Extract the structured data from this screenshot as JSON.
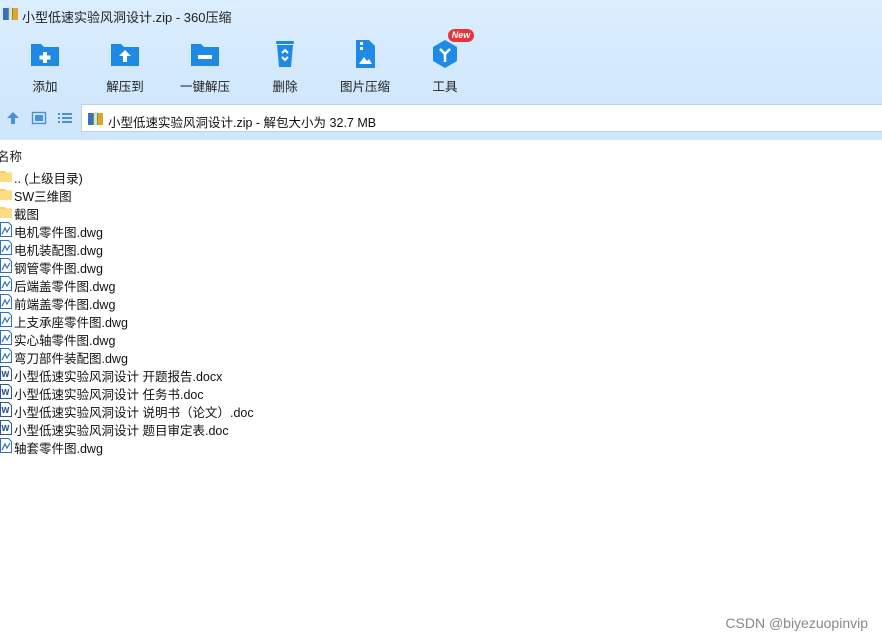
{
  "window": {
    "title": "小型低速实验风洞设计.zip - 360压缩"
  },
  "toolbar": {
    "add_label": "添加",
    "extract_to_label": "解压到",
    "one_click_extract_label": "一键解压",
    "delete_label": "删除",
    "image_compress_label": "图片压缩",
    "tools_label": "工具",
    "tools_badge": "New"
  },
  "address": {
    "path": "小型低速实验风洞设计.zip - 解包大小为 32.7 MB"
  },
  "list": {
    "column_name": "名称",
    "items": [
      {
        "name": ".. (上级目录)",
        "type": "folder"
      },
      {
        "name": "SW三维图",
        "type": "folder"
      },
      {
        "name": "截图",
        "type": "folder"
      },
      {
        "name": "电机零件图.dwg",
        "type": "dwg"
      },
      {
        "name": "电机装配图.dwg",
        "type": "dwg"
      },
      {
        "name": "钢管零件图.dwg",
        "type": "dwg"
      },
      {
        "name": "后端盖零件图.dwg",
        "type": "dwg"
      },
      {
        "name": "前端盖零件图.dwg",
        "type": "dwg"
      },
      {
        "name": "上支承座零件图.dwg",
        "type": "dwg"
      },
      {
        "name": "实心轴零件图.dwg",
        "type": "dwg"
      },
      {
        "name": "弯刀部件装配图.dwg",
        "type": "dwg"
      },
      {
        "name": "小型低速实验风洞设计 开题报告.docx",
        "type": "doc"
      },
      {
        "name": "小型低速实验风洞设计 任务书.doc",
        "type": "doc"
      },
      {
        "name": "小型低速实验风洞设计 说明书（论文）.doc",
        "type": "doc"
      },
      {
        "name": "小型低速实验风洞设计 题目审定表.doc",
        "type": "doc"
      },
      {
        "name": "轴套零件图.dwg",
        "type": "dwg"
      }
    ]
  },
  "watermark": "CSDN @biyezuopinvip",
  "colors": {
    "toolbar_icon_blue": "#1e8ae6",
    "chrome_background": "#d6ebfd",
    "new_badge": "#e8333a",
    "folder_yellow": "#f7cf63"
  }
}
